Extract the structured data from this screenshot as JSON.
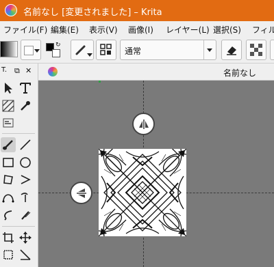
{
  "window": {
    "title": "名前なし [変更されました] – Krita"
  },
  "menu": {
    "items": [
      "ファイル(F)",
      "編集(E)",
      "表示(V)",
      "画像(I)",
      "レイヤー(L)",
      "選択(S)",
      "フィルタ"
    ]
  },
  "toolbar": {
    "blend_mode": "通常"
  },
  "toolbox": {
    "title": "T."
  },
  "document": {
    "tab_name": "名前なし"
  },
  "colors": {
    "titlebar": "#e26b12",
    "canvas_bg": "#7a7a7a",
    "accent_green": "#2ea043"
  }
}
